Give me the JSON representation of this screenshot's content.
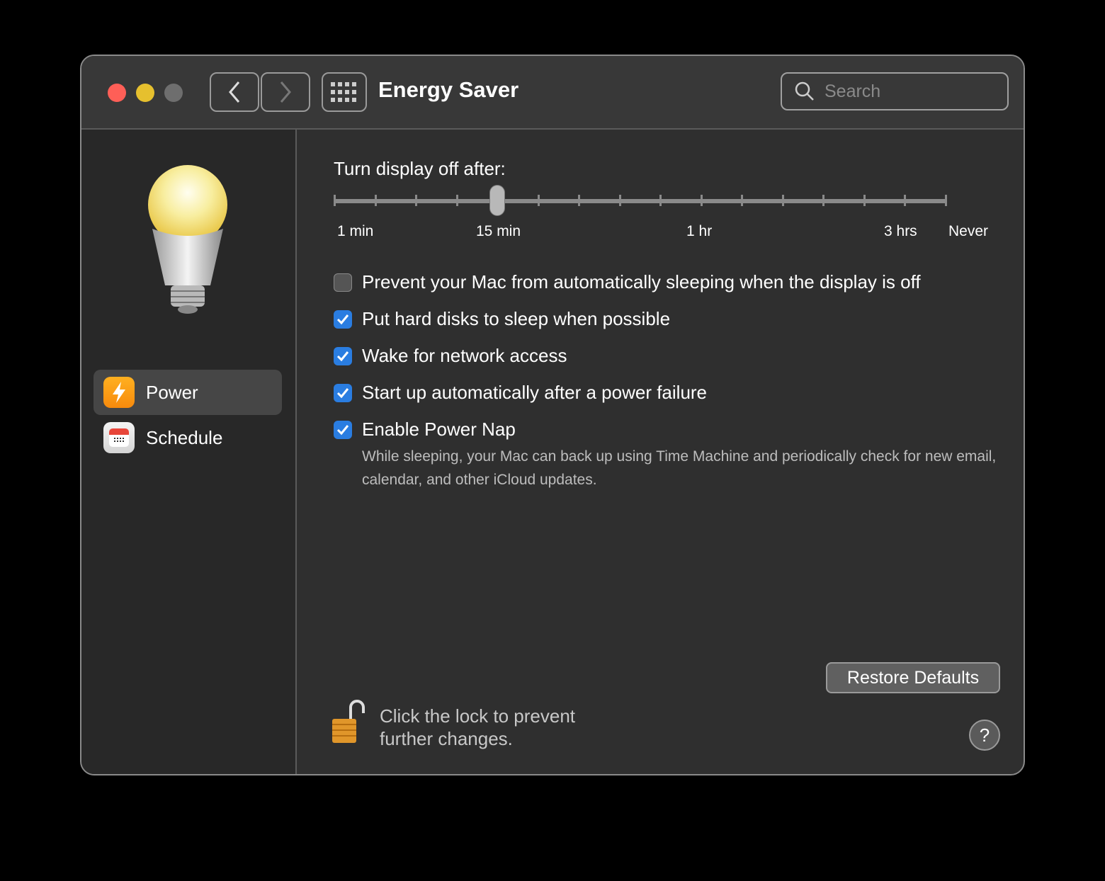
{
  "window": {
    "title": "Energy Saver",
    "search_placeholder": "Search"
  },
  "sidebar": {
    "items": [
      {
        "label": "Power",
        "selected": true
      },
      {
        "label": "Schedule",
        "selected": false
      }
    ]
  },
  "display_sleep": {
    "label": "Turn display off after:",
    "tick_labels": [
      "1 min",
      "15 min",
      "1 hr",
      "3 hrs",
      "Never"
    ],
    "value": "15 min",
    "tick_count": 16,
    "selected_tick_index": 4
  },
  "options": [
    {
      "label": "Prevent your Mac from automatically sleeping when the display is off",
      "checked": false
    },
    {
      "label": "Put hard disks to sleep when possible",
      "checked": true
    },
    {
      "label": "Wake for network access",
      "checked": true
    },
    {
      "label": "Start up automatically after a power failure",
      "checked": true
    },
    {
      "label": "Enable Power Nap",
      "checked": true
    }
  ],
  "power_nap_description": "While sleeping, your Mac can back up using Time Machine and periodically check for new email, calendar, and other iCloud updates.",
  "restore_defaults": "Restore Defaults",
  "lock": {
    "line1": "Click the lock to prevent",
    "line2": "further changes."
  },
  "help": "?"
}
